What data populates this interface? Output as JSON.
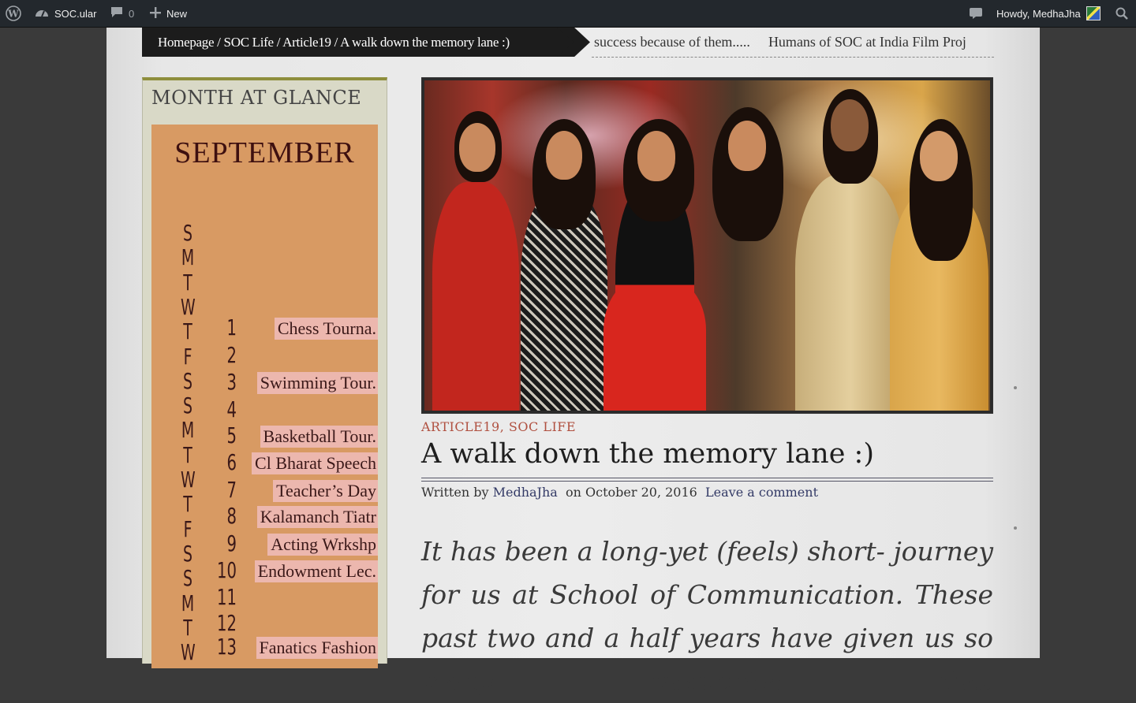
{
  "adminbar": {
    "site_name": "SOC.ular",
    "comment_count": "0",
    "new_label": "New",
    "howdy": "Howdy, MedhaJha",
    "icons": [
      "wordpress-icon",
      "dashboard-icon",
      "comment-icon",
      "plus-icon",
      "notification-icon",
      "search-icon"
    ]
  },
  "breadcrumb": "Homepage / SOC Life / Article19 / A walk down the memory lane :)",
  "ticker": {
    "items": [
      "success because of them.....",
      "Humans of SOC at India Film Proj"
    ]
  },
  "widget": {
    "title": "MONTH AT GLANCE",
    "month": "SEPTEMBER",
    "days": [
      "S",
      "M",
      "T",
      "W",
      "T",
      "F",
      "S",
      "S",
      "M",
      "T",
      "W",
      "T",
      "F",
      "S",
      "S",
      "M",
      "T",
      "W"
    ],
    "dates": [
      "1",
      "2",
      "3",
      "4",
      "5",
      "6",
      "7",
      "8",
      "9",
      "10",
      "11",
      "12",
      "13"
    ],
    "events": [
      "Chess Tourna.",
      "",
      "Swimming Tour.",
      "",
      "Basketball Tour.",
      "Cl Bharat Speech",
      "Teacher’s Day",
      "Kalamanch Tiatr",
      "Acting Wrkshp",
      "Endowment Lec.",
      "",
      "",
      "Fanatics Fashion"
    ]
  },
  "post": {
    "categories": [
      "ARTICLE19",
      "SOC LIFE"
    ],
    "category_sep": ",",
    "title": "A walk down the memory lane :)",
    "written_by": "Written by",
    "author": "MedhaJha",
    "date_prefix": "on",
    "date": "October 20, 2016",
    "comment_link": "Leave a comment",
    "excerpt": "It has been a long-yet (feels) short- journey for us at School of Communication. These past two and a half years have given us so many memories that"
  },
  "colors": {
    "adminbar": "#23282d",
    "calendar": "#d89a63",
    "event_highlight": "#ecb7ae",
    "category": "#b05040",
    "widget_border": "#8e8e3c"
  }
}
